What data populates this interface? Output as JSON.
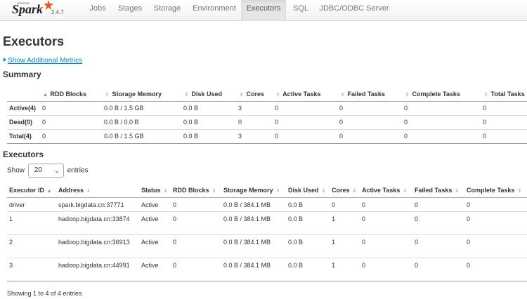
{
  "navbar": {
    "apache": "APACHE",
    "brand": "Spark",
    "version": "2.4.7",
    "tabs": [
      {
        "label": "Jobs",
        "active": false
      },
      {
        "label": "Stages",
        "active": false
      },
      {
        "label": "Storage",
        "active": false
      },
      {
        "label": "Environment",
        "active": false
      },
      {
        "label": "Executors",
        "active": true
      },
      {
        "label": "SQL",
        "active": false
      },
      {
        "label": "JDBC/ODBC Server",
        "active": false
      }
    ]
  },
  "page": {
    "title": "Executors",
    "show_metrics": "Show Additional Metrics"
  },
  "summary": {
    "heading": "Summary",
    "columns": [
      "",
      "RDD Blocks",
      "Storage Memory",
      "Disk Used",
      "Cores",
      "Active Tasks",
      "Failed Tasks",
      "Complete Tasks",
      "Total Tasks"
    ],
    "rows": [
      [
        "Active(4)",
        "0",
        "0.0 B / 1.5 GB",
        "0.0 B",
        "3",
        "0",
        "0",
        "0",
        "0"
      ],
      [
        "Dead(0)",
        "0",
        "0.0 B / 0.0 B",
        "0.0 B",
        "0",
        "0",
        "0",
        "0",
        "0"
      ],
      [
        "Total(4)",
        "0",
        "0.0 B / 1.5 GB",
        "0.0 B",
        "3",
        "0",
        "0",
        "0",
        "0"
      ]
    ]
  },
  "executors": {
    "heading": "Executors",
    "show_label": "Show",
    "entries_value": "20",
    "entries_label": "entries",
    "columns": [
      "Executor ID",
      "Address",
      "Status",
      "RDD Blocks",
      "Storage Memory",
      "Disk Used",
      "Cores",
      "Active Tasks",
      "Failed Tasks",
      "Complete Tasks"
    ],
    "rows": [
      [
        "driver",
        "spark.bigdata.cn:37771",
        "Active",
        "0",
        "0.0 B / 384.1 MB",
        "0.0 B",
        "0",
        "0",
        "0",
        "0"
      ],
      [
        "1",
        "hadoop.bigdata.cn:33874",
        "Active",
        "0",
        "0.0 B / 384.1 MB",
        "0.0 B",
        "1",
        "0",
        "0",
        "0"
      ],
      [
        "2",
        "hadoop.bigdata.cn:36913",
        "Active",
        "0",
        "0.0 B / 384.1 MB",
        "0.0 B",
        "1",
        "0",
        "0",
        "0"
      ],
      [
        "3",
        "hadoop.bigdata.cn:44991",
        "Active",
        "0",
        "0.0 B / 384.1 MB",
        "0.0 B",
        "1",
        "0",
        "0",
        "0"
      ]
    ],
    "footer": "Showing 1 to 4 of 4 entries"
  }
}
